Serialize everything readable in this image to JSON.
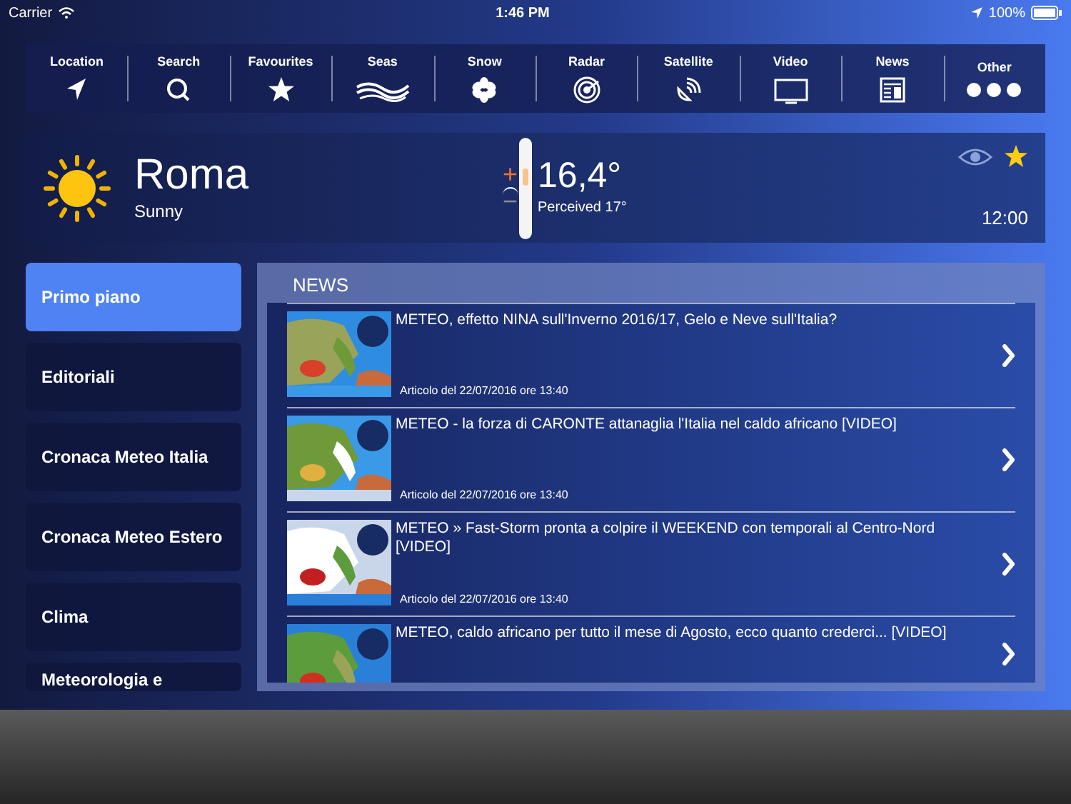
{
  "status_bar": {
    "carrier": "Carrier",
    "time": "1:46 PM",
    "battery": "100%"
  },
  "nav": [
    {
      "label": "Location",
      "kind": "location"
    },
    {
      "label": "Search",
      "kind": "search"
    },
    {
      "label": "Favourites",
      "kind": "star"
    },
    {
      "label": "Seas",
      "kind": "waves"
    },
    {
      "label": "Snow",
      "kind": "snow"
    },
    {
      "label": "Radar",
      "kind": "radar"
    },
    {
      "label": "Satellite",
      "kind": "satellite"
    },
    {
      "label": "Video",
      "kind": "tv"
    },
    {
      "label": "News",
      "kind": "news"
    },
    {
      "label": "Other",
      "kind": "dots"
    }
  ],
  "weather": {
    "city": "Roma",
    "condition": "Sunny",
    "plus": "+",
    "minus": "−",
    "temperature": "16,4°",
    "perceived": "Perceived 17°",
    "time": "12:00"
  },
  "sidebar": {
    "items": [
      {
        "label": "Primo piano",
        "selected": true
      },
      {
        "label": "Editoriali",
        "selected": false
      },
      {
        "label": "Cronaca Meteo Italia",
        "selected": false
      },
      {
        "label": "Cronaca Meteo Estero",
        "selected": false
      },
      {
        "label": "Clima",
        "selected": false
      },
      {
        "label": "Meteorologia e",
        "selected": false
      }
    ]
  },
  "news": {
    "title": "NEWS",
    "items": [
      {
        "headline": "METEO, effetto NINA sull'Inverno 2016/17, Gelo e Neve sull'Italia?",
        "date": "Articolo del 22/07/2016 ore 13:40"
      },
      {
        "headline": "METEO - la forza di CARONTE attanaglia l'Italia nel caldo africano [VIDEO]",
        "date": "Articolo del 22/07/2016 ore 13:40"
      },
      {
        "headline": "METEO » Fast-Storm pronta a colpire il WEEKEND con temporali al Centro-Nord [VIDEO]",
        "date": "Articolo del 22/07/2016 ore 13:40"
      },
      {
        "headline": "METEO, caldo africano per tutto il mese di Agosto, ecco quanto crederci... [VIDEO]"
      }
    ]
  }
}
